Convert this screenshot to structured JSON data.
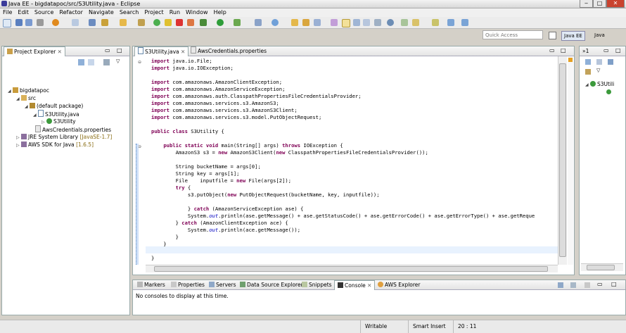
{
  "window": {
    "title": "Java EE - bigdatapoc/src/S3Utility.java - Eclipse",
    "minimize": "‒",
    "maximize": "□",
    "close": "✕"
  },
  "menu": [
    "File",
    "Edit",
    "Source",
    "Refactor",
    "Navigate",
    "Search",
    "Project",
    "Run",
    "Window",
    "Help"
  ],
  "quick_access": {
    "placeholder": "Quick Access"
  },
  "perspectives": {
    "java_ee": "Java EE",
    "java": "Java"
  },
  "project_explorer": {
    "tab": "Project Explorer",
    "tree": [
      {
        "label": "bigdatapoc",
        "icon": "project-icon"
      },
      {
        "label": "src",
        "icon": "source-folder-icon"
      },
      {
        "label": "(default package)",
        "icon": "package-icon"
      },
      {
        "label": "S3Utility.java",
        "icon": "java-file-icon"
      },
      {
        "label": "S3Utility",
        "icon": "class-icon"
      },
      {
        "label": "AwsCredentials.properties",
        "icon": "properties-file-icon"
      },
      {
        "label": "JRE System Library",
        "suffix": "[JavaSE-1.7]",
        "icon": "library-icon"
      },
      {
        "label": "AWS SDK for Java",
        "suffix": "[1.6.5]",
        "icon": "library-icon"
      }
    ]
  },
  "editor": {
    "tabs": [
      {
        "label": "S3Utility.java",
        "active": true
      },
      {
        "label": "AwsCredentials.properties",
        "active": false
      }
    ],
    "code": [
      "import java.io.File;",
      "import java.io.IOException;",
      "",
      "import com.amazonaws.AmazonClientException;",
      "import com.amazonaws.AmazonServiceException;",
      "import com.amazonaws.auth.ClasspathPropertiesFileCredentialsProvider;",
      "import com.amazonaws.services.s3.AmazonS3;",
      "import com.amazonaws.services.s3.AmazonS3Client;",
      "import com.amazonaws.services.s3.model.PutObjectRequest;",
      "",
      "public class S3Utility {",
      "",
      "    public static void main(String[] args) throws IOException {",
      "        AmazonS3 s3 = new AmazonS3Client(new ClasspathPropertiesFileCredentialsProvider());",
      "",
      "        String bucketName = args[0];",
      "        String key = args[1];",
      "        File    inputfile = new File(args[2]);",
      "        try {",
      "            s3.putObject(new PutObjectRequest(bucketName, key, inputfile));",
      "",
      "            } catch (AmazonServiceException ase) {",
      "            System.out.println(ase.getMessage() + ase.getStatusCode() + ase.getErrorCode() + ase.getErrorType() + ase.getReque",
      "        } catch (AmazonClientException ace) {",
      "            System.out.println(ace.getMessage());",
      "        }",
      "    }",
      "",
      "}"
    ]
  },
  "outline": {
    "tab_count": "»1",
    "class": "S3Utili"
  },
  "bottom_panel": {
    "tabs": [
      "Markers",
      "Properties",
      "Servers",
      "Data Source Explorer",
      "Snippets",
      "Console",
      "AWS Explorer"
    ],
    "active_tab": "Console",
    "message": "No consoles to display at this time."
  },
  "status_bar": {
    "writable": "Writable",
    "insert_mode": "Smart Insert",
    "position": "20 : 11"
  },
  "colors": {
    "keyword": "#7f0055",
    "field": "#0000c0",
    "current_line": "#e8f2fe"
  }
}
